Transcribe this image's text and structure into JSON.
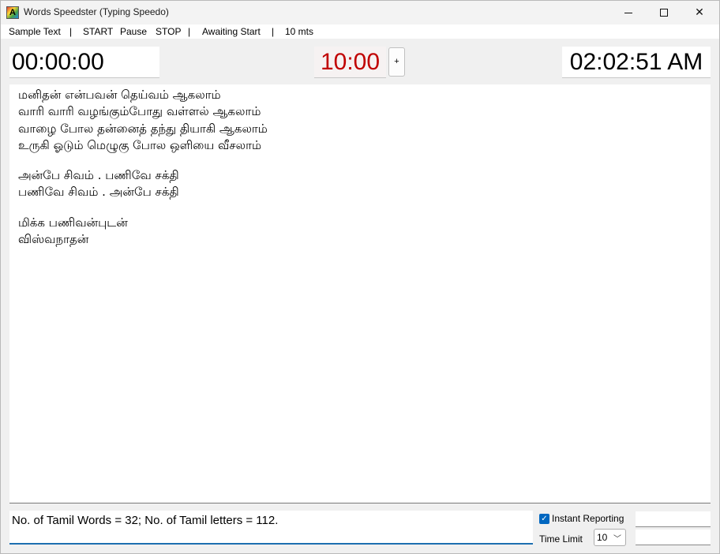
{
  "window": {
    "title": "Words Speedster (Typing Speedo)",
    "icon_letter": "A"
  },
  "menu": {
    "items": [
      "Sample Text",
      "|",
      "START",
      "Pause",
      "STOP",
      "|",
      "Awaiting Start",
      "|",
      "10 mts"
    ]
  },
  "timers": {
    "elapsed": "00:00:00",
    "countdown": "10:00",
    "add_button": "+",
    "clock": "02:02:51 AM"
  },
  "sample_text": {
    "lines": [
      "மனிதன் என்பவன் தெய்வம் ஆகலாம்",
      "வாரி வாரி வழங்கும்போது வள்ளல் ஆகலாம்",
      "வாழை போல தன்னைத் தந்து தியாகி ஆகலாம்",
      "உருகி ஓடும் மெழுகு போல ஒளியை வீசலாம்",
      "அன்பே சிவம் . பணிவே சக்தி",
      "பணிவே சிவம் . அன்பே சக்தி",
      "மிக்க பணிவன்புடன்",
      "விஸ்வநாதன்"
    ]
  },
  "report": {
    "text": "No. of Tamil Words = 32; No. of Tamil letters = 112."
  },
  "options": {
    "instant_reporting_label": "Instant Reporting",
    "instant_reporting_checked": true,
    "time_limit_label": "Time Limit",
    "time_limit_value": "10"
  },
  "colors": {
    "countdown": "#c00000",
    "accent": "#0067c0"
  }
}
